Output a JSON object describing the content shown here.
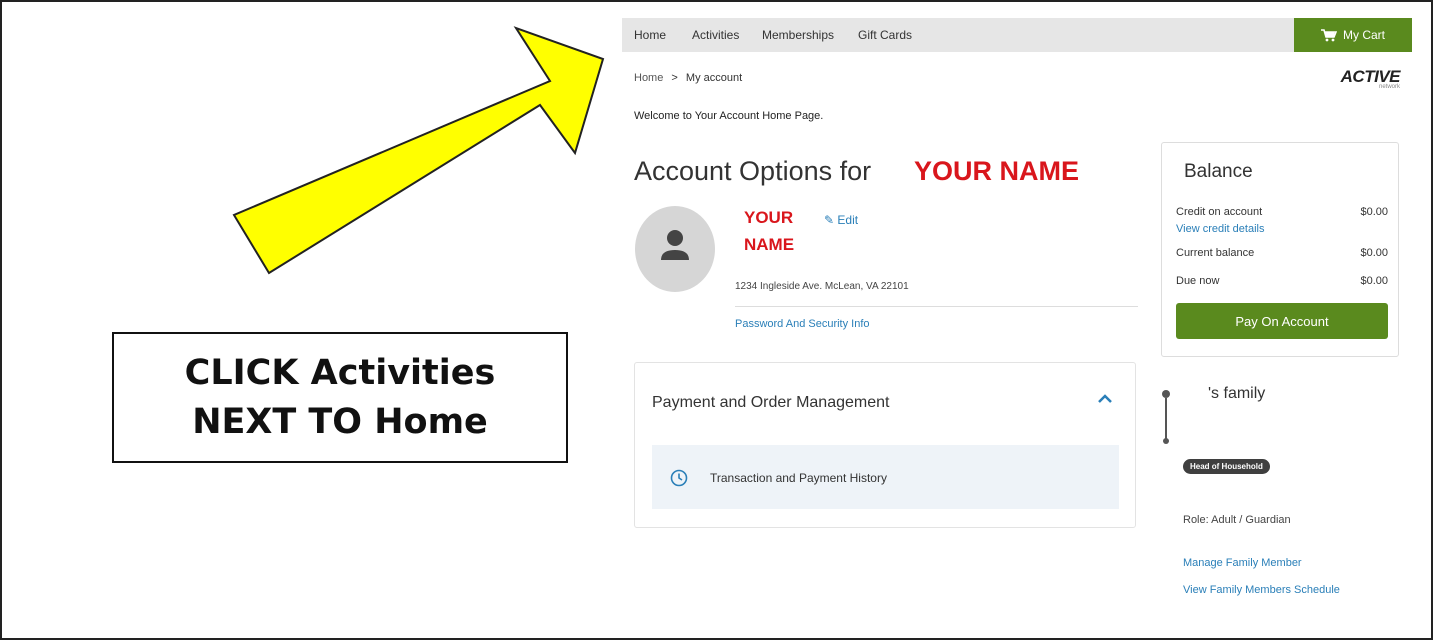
{
  "nav": {
    "items": [
      "Home",
      "Activities",
      "Memberships",
      "Gift Cards"
    ],
    "cart_label": "My Cart"
  },
  "breadcrumb": {
    "home": "Home",
    "separator": ">",
    "current": "My account"
  },
  "logo": {
    "text": "ACTIVE",
    "sub": "network"
  },
  "welcome": "Welcome to Your Account Home Page.",
  "account": {
    "title": "Account Options for ",
    "name_placeholder": "YOUR NAME"
  },
  "profile": {
    "name": "YOUR NAME",
    "edit_label": "Edit",
    "address": "1234 Ingleside Ave. McLean, VA 22101",
    "password_link": "Password And Security Info"
  },
  "balance": {
    "title": "Balance",
    "rows": [
      {
        "label": "Credit on account",
        "value": "$0.00"
      },
      {
        "label": "Current balance",
        "value": "$0.00"
      },
      {
        "label": "Due now",
        "value": "$0.00"
      }
    ],
    "credit_link": "View credit details",
    "pay_button": "Pay On Account"
  },
  "payment_mgmt": {
    "title": "Payment and Order Management",
    "item": "Transaction and Payment History"
  },
  "family": {
    "title": "'s family",
    "badge": "Head of Household",
    "role_label": "Role:",
    "role_value": "Adult / Guardian",
    "links": [
      "Manage Family Member",
      "View Family Members Schedule"
    ]
  },
  "callout": {
    "line1": "CLICK Activities",
    "line2": "NEXT TO Home"
  },
  "colors": {
    "accent_green": "#5a8a1e",
    "link_blue": "#2a7fb8",
    "annotation_red": "#d9161c",
    "arrow_yellow": "#ffff00"
  }
}
